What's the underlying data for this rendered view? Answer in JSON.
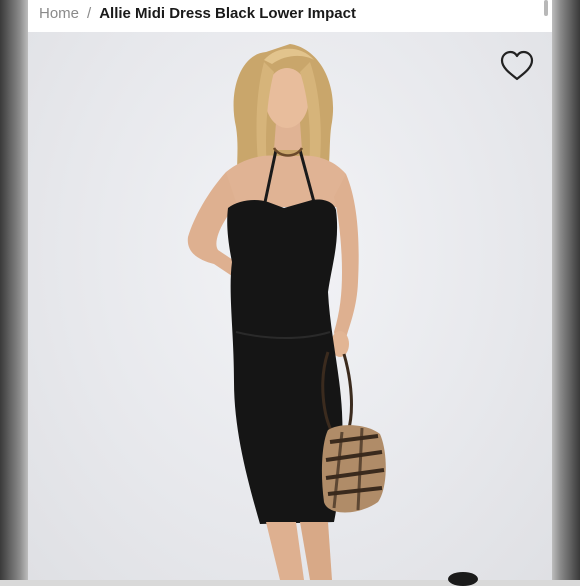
{
  "breadcrumb": {
    "home": "Home",
    "separator": "/",
    "current": "Allie Midi Dress Black Lower Impact"
  },
  "product_image": {
    "alt": "Model wearing black halter midi dress holding zebra print bag"
  },
  "icons": {
    "wishlist": "heart-outline-icon"
  },
  "colors": {
    "background": "#e9eaed",
    "dress": "#141414",
    "text_primary": "#1a1a1a",
    "text_muted": "#8a8a8a"
  }
}
